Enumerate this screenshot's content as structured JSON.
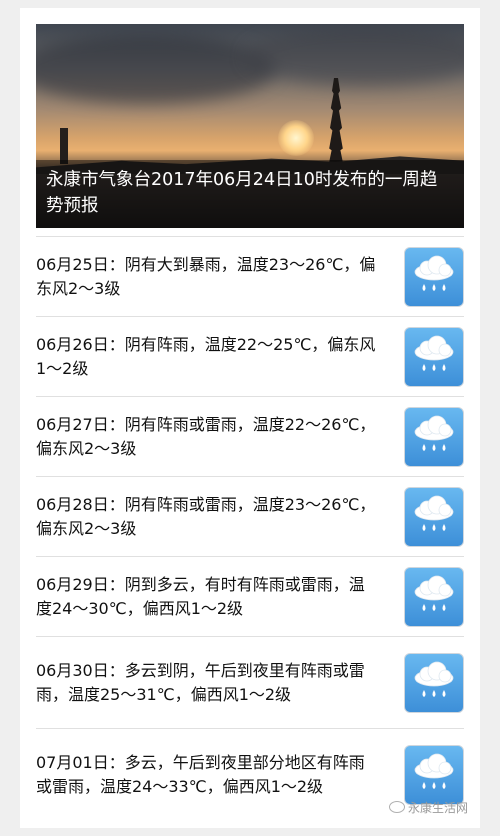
{
  "header": {
    "caption": "永康市气象台2017年06月24日10时发布的一周趋势预报"
  },
  "forecast": [
    {
      "text": "06月25日：阴有大到暴雨，温度23～26℃，偏东风2～3级",
      "icon": "rain-cloud-icon"
    },
    {
      "text": "06月26日：阴有阵雨，温度22～25℃，偏东风1～2级",
      "icon": "rain-cloud-icon"
    },
    {
      "text": "06月27日：阴有阵雨或雷雨，温度22～26℃，偏东风2～3级",
      "icon": "rain-cloud-icon"
    },
    {
      "text": "06月28日：阴有阵雨或雷雨，温度23～26℃，偏东风2～3级",
      "icon": "rain-cloud-icon"
    },
    {
      "text": "06月29日：阴到多云，有时有阵雨或雷雨，温度24～30℃，偏西风1～2级",
      "icon": "rain-cloud-icon"
    },
    {
      "text": "06月30日：多云到阴，午后到夜里有阵雨或雷雨，温度25～31℃，偏西风1～2级",
      "icon": "rain-cloud-icon"
    },
    {
      "text": "07月01日：多云，午后到夜里部分地区有阵雨或雷雨，温度24～33℃，偏西风1～2级",
      "icon": "rain-cloud-icon"
    }
  ],
  "watermark": "永康生活网",
  "colors": {
    "icon_bg_top": "#68b8f0",
    "icon_bg_bottom": "#3d8fd8"
  }
}
